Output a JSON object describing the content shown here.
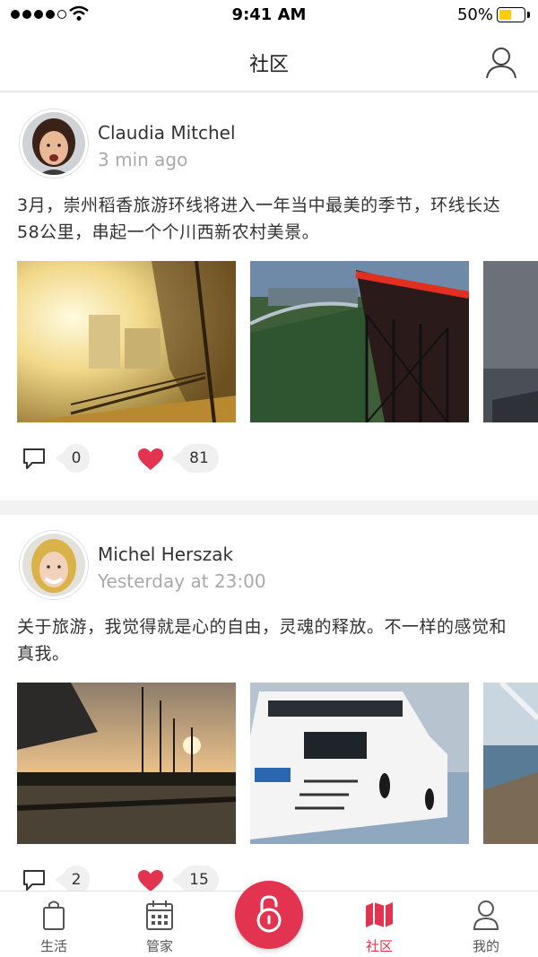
{
  "status_bar": {
    "time": "9:41 AM",
    "battery": "50%"
  },
  "nav": {
    "title": "社区",
    "profile_icon": "person-icon"
  },
  "posts": [
    {
      "author": "Claudia Mitchel",
      "time": "3 min ago",
      "text": "3月，崇州稻香旅游环线将进入一年当中最美的季节，环线长达58公里，串起一个个川西新农村美景。",
      "comments": "0",
      "likes": "81"
    },
    {
      "author": "Michel Herszak",
      "time": "Yesterday at 23:00",
      "text": "关于旅游，我觉得就是心的自由，灵魂的释放。不一样的感觉和真我。",
      "comments": "2",
      "likes": "15"
    }
  ],
  "tabs": [
    {
      "label": "生活",
      "icon": "bag-icon"
    },
    {
      "label": "管家",
      "icon": "calendar-icon"
    },
    {
      "label": "",
      "icon": "lock-icon"
    },
    {
      "label": "社区",
      "icon": "map-icon"
    },
    {
      "label": "我的",
      "icon": "user-icon"
    }
  ],
  "colors": {
    "accent": "#e23450",
    "background": "#f2f2f2"
  }
}
